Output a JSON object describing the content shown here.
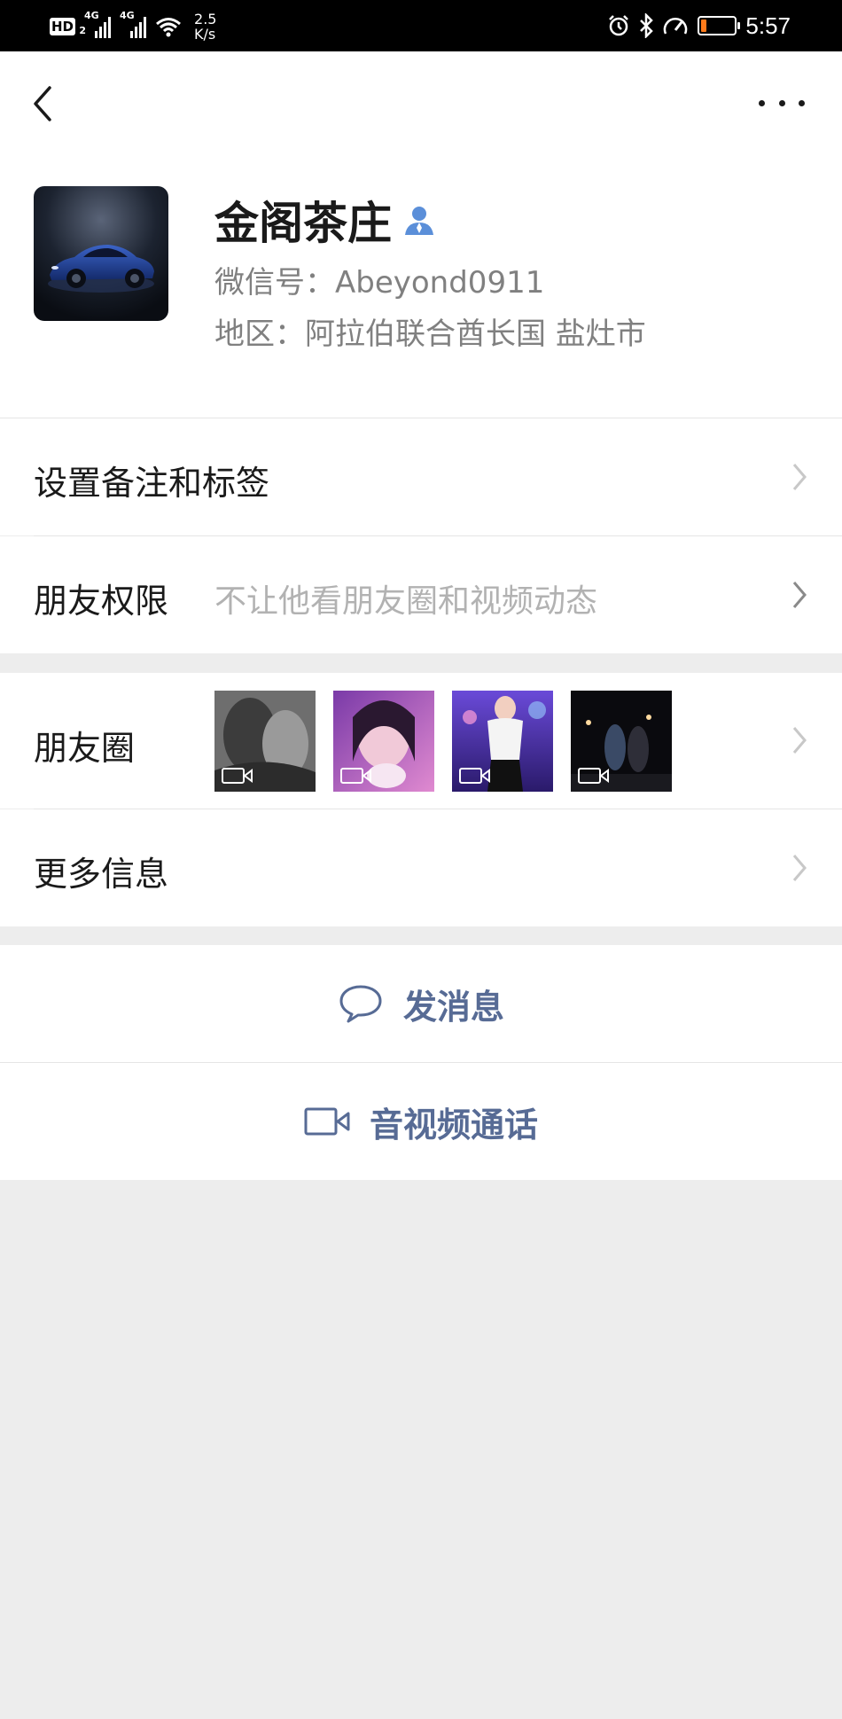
{
  "status_bar": {
    "hd_label": "HD",
    "hd_sub": "2",
    "net1": "4G",
    "net2": "4G",
    "speed_value": "2.5",
    "speed_unit": "K/s",
    "time": "5:57",
    "battery_level": 0.18,
    "battery_color": "#ff7a1a"
  },
  "header": {
    "name": "金阁茶庄",
    "wechat_id": "微信号：Abeyond0911",
    "region": "地区：阿拉伯联合酋长国  盐灶市",
    "verified_icon": "person-badge-icon"
  },
  "rows": {
    "remark": {
      "label": "设置备注和标签"
    },
    "permission": {
      "label": "朋友权限",
      "value": "不让他看朋友圈和视频动态"
    },
    "moments": {
      "label": "朋友圈",
      "thumbnails": 4
    },
    "more_info": {
      "label": "更多信息"
    }
  },
  "actions": {
    "message": {
      "label": "发消息",
      "icon": "chat-bubble-icon"
    },
    "call": {
      "label": "音视频通话",
      "icon": "video-camera-icon"
    }
  },
  "colors": {
    "link_blue": "#576b95",
    "page_bg": "#ededed",
    "secondary_text": "#808080"
  }
}
